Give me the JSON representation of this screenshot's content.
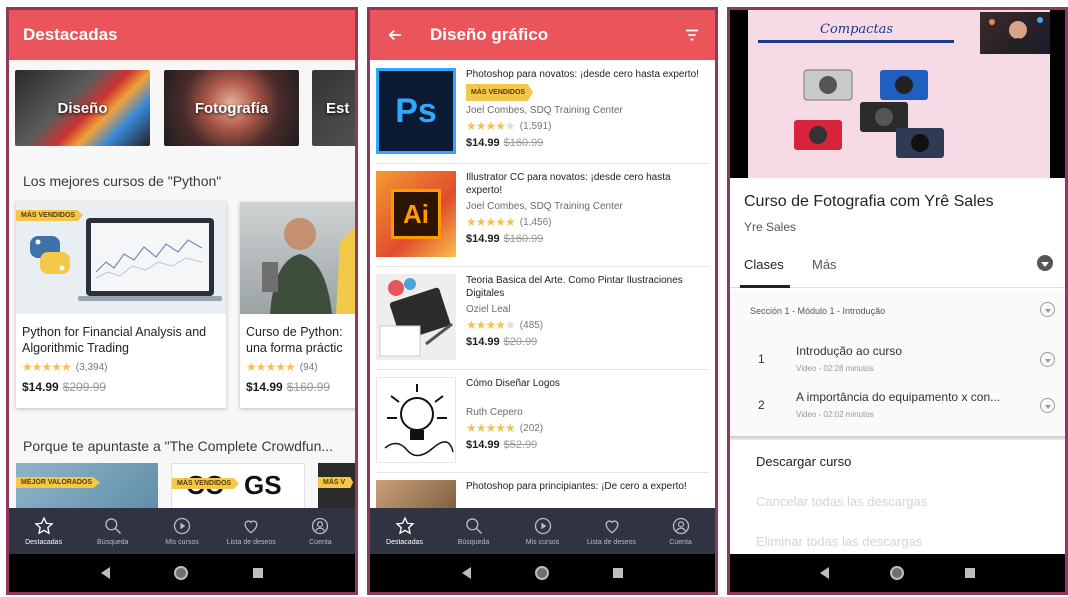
{
  "panel1": {
    "title": "Destacadas",
    "categories": [
      {
        "label": "Diseño"
      },
      {
        "label": "Fotografía"
      },
      {
        "label": "Est"
      }
    ],
    "section1_title": "Los mejores cursos de \"Python\"",
    "courses": [
      {
        "badge": "MÁS VENDIDOS",
        "title": "Python for Financial Analysis and Algorithmic Trading",
        "rating_count": "(3,394)",
        "price": "$14.99",
        "old_price": "$209.99",
        "stars": 4.5
      },
      {
        "badge": "",
        "title": "Curso de Python: una forma práctic",
        "rating_count": "(94)",
        "price": "$14.99",
        "old_price": "$160.99",
        "stars": 4.5
      }
    ],
    "section2_title": "Porque te apuntaste a \"The Complete Crowdfun...",
    "section2_badges": [
      "MEJOR VALORADOS",
      "MÁS VENDIDOS",
      "MÁS V"
    ],
    "nav": [
      {
        "label": "Destacadas",
        "icon": "star-icon",
        "active": true
      },
      {
        "label": "Búsqueda",
        "icon": "search-icon",
        "active": false
      },
      {
        "label": "Mis cursos",
        "icon": "play-icon",
        "active": false
      },
      {
        "label": "Lista de deseos",
        "icon": "heart-icon",
        "active": false
      },
      {
        "label": "Cuenta",
        "icon": "account-icon",
        "active": false
      }
    ]
  },
  "panel2": {
    "title": "Diseño gráfico",
    "courses": [
      {
        "thumb_label": "Ps",
        "title": "Photoshop para novatos: ¡desde cero hasta experto!",
        "badge": "MÁS VENDIDOS",
        "instructor": "Joel Combes, SDQ Training Center",
        "rating_count": "(1,591)",
        "price": "$14.99",
        "old_price": "$160.99",
        "stars": 4
      },
      {
        "thumb_label": "Ai",
        "title": "Illustrator CC para novatos: ¡desde cero hasta experto!",
        "badge": "",
        "instructor": "Joel Combes, SDQ Training Center",
        "rating_count": "(1,456)",
        "price": "$14.99",
        "old_price": "$160.99",
        "stars": 4.5
      },
      {
        "thumb_label": "",
        "title": "Teoria Basica del Arte. Como Pintar Ilustraciones Digitales",
        "badge": "",
        "instructor": "Oziel Leal",
        "rating_count": "(485)",
        "price": "$14.99",
        "old_price": "$20.99",
        "stars": 4
      },
      {
        "thumb_label": "",
        "title": "Cómo Diseñar Logos",
        "badge": "",
        "instructor": "Ruth Cepero",
        "rating_count": "(202)",
        "price": "$14.99",
        "old_price": "$52.99",
        "stars": 4.5
      },
      {
        "thumb_label": "",
        "title": "Photoshop para principiantes: ¡De cero a experto!",
        "badge": "",
        "instructor": "",
        "rating_count": "",
        "price": "",
        "old_price": "",
        "stars": 0
      }
    ],
    "nav": [
      {
        "label": "Destacadas",
        "icon": "star-icon",
        "active": true
      },
      {
        "label": "Búsqueda",
        "icon": "search-icon",
        "active": false
      },
      {
        "label": "Mis cursos",
        "icon": "play-icon",
        "active": false
      },
      {
        "label": "Lista de deseos",
        "icon": "heart-icon",
        "active": false
      },
      {
        "label": "Cuenta",
        "icon": "account-icon",
        "active": false
      }
    ]
  },
  "panel3": {
    "video_caption": "Compactas",
    "course_title": "Curso de Fotografia com Yrê Sales",
    "instructor": "Yre Sales",
    "tabs": [
      "Clases",
      "Más"
    ],
    "section_label": "Sección 1 - Módulo 1 - Introdução",
    "lessons": [
      {
        "num": "1",
        "title": "Introdução ao curso",
        "meta": "Video - 02:28 minutos"
      },
      {
        "num": "2",
        "title": "A importância do equipamento x con...",
        "meta": "Video - 02:02 minutos"
      }
    ],
    "menu": [
      {
        "label": "Descargar curso",
        "enabled": true
      },
      {
        "label": "Cancelar todas las descargas",
        "enabled": false
      },
      {
        "label": "Eliminar todas las descargas",
        "enabled": false
      }
    ]
  },
  "colors": {
    "accent": "#e9555a",
    "nav_bg": "#2f3342",
    "star": "#f4c150",
    "badge": "#f3c74b"
  }
}
